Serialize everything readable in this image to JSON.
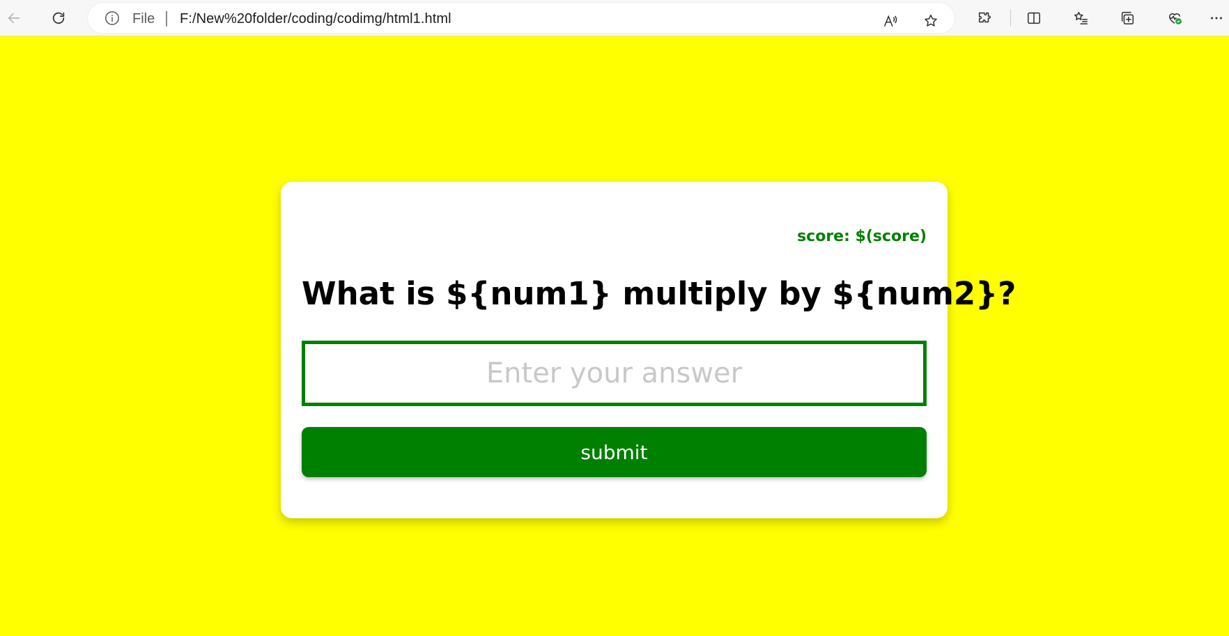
{
  "browser": {
    "address_prefix": "File",
    "url": "F:/New%20folder/coding/codimg/html1.html"
  },
  "colors": {
    "page_background": "#ffff00",
    "accent": "#008000"
  },
  "quiz": {
    "score_label": "score: $(score)",
    "question": "What is ${num1} multiply by ${num2}?",
    "answer_placeholder": "Enter your answer",
    "submit_label": "submit"
  }
}
